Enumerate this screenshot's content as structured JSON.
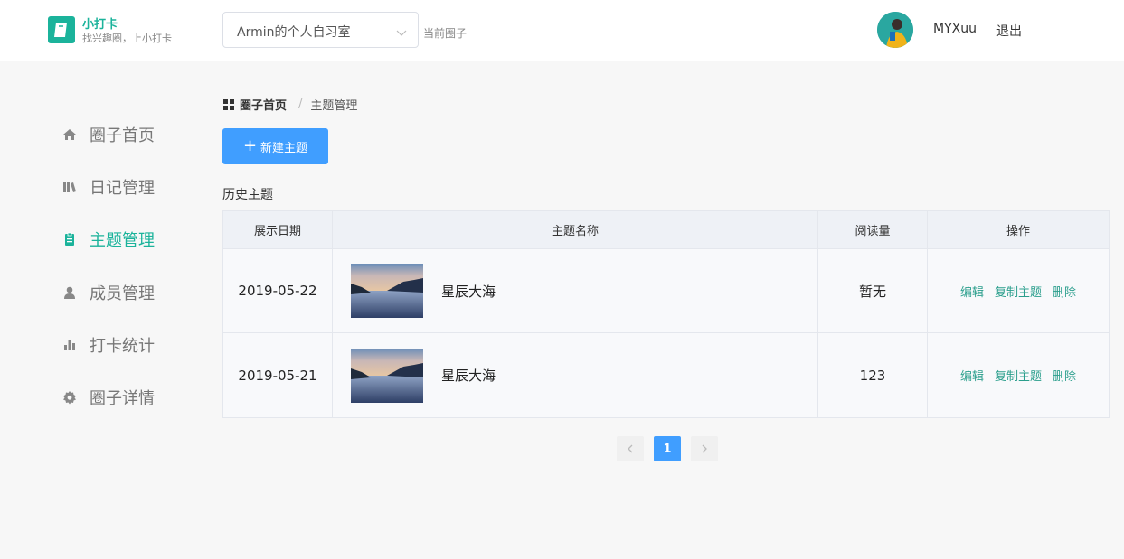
{
  "brand": {
    "name": "小打卡",
    "slogan": "找兴趣圈，上小打卡"
  },
  "circle_select": {
    "value": "Armin的个人自习室",
    "hint": "当前圈子"
  },
  "user": {
    "name": "MYXuu",
    "logout": "退出"
  },
  "sidebar": {
    "items": [
      {
        "label": "圈子首页",
        "icon": "home-icon"
      },
      {
        "label": "日记管理",
        "icon": "book-icon"
      },
      {
        "label": "主题管理",
        "icon": "clipboard-icon",
        "active": true
      },
      {
        "label": "成员管理",
        "icon": "user-icon"
      },
      {
        "label": "打卡统计",
        "icon": "bar-chart-icon"
      },
      {
        "label": "圈子详情",
        "icon": "gear-icon"
      }
    ]
  },
  "breadcrumb": {
    "home": "圈子首页",
    "current": "主题管理"
  },
  "new_button": "新建主题",
  "section_title": "历史主题",
  "table": {
    "headers": [
      "展示日期",
      "主题名称",
      "阅读量",
      "操作"
    ],
    "rows": [
      {
        "date": "2019-05-22",
        "name": "星辰大海",
        "reads": "暂无"
      },
      {
        "date": "2019-05-21",
        "name": "星辰大海",
        "reads": "123"
      }
    ],
    "actions": {
      "edit": "编辑",
      "copy": "复制主题",
      "delete": "删除"
    }
  },
  "pagination": {
    "current": "1"
  },
  "colors": {
    "accent": "#1bb39b",
    "primary": "#409eff",
    "link": "#2a9e8c"
  }
}
